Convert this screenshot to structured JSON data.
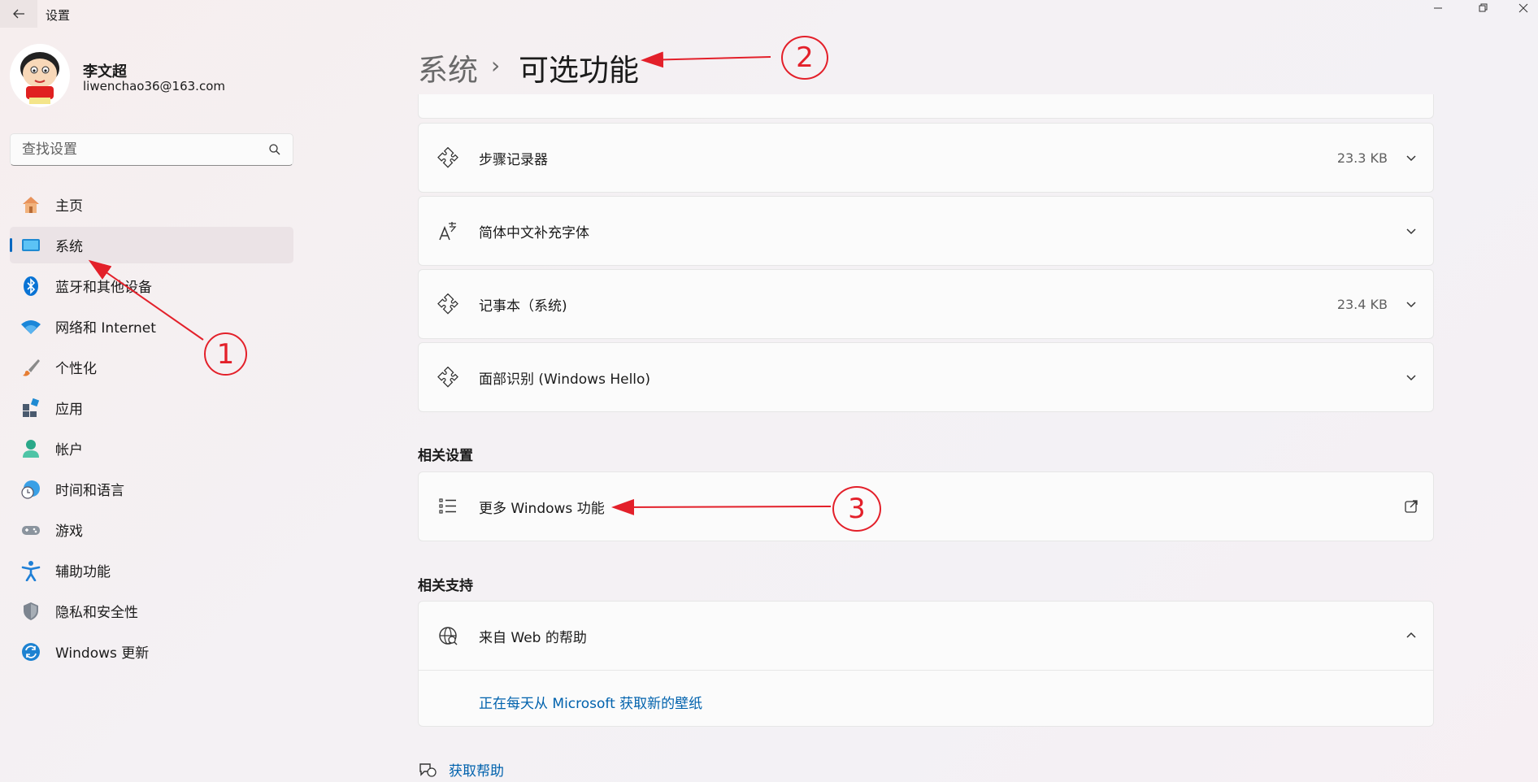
{
  "window": {
    "title": "设置"
  },
  "user": {
    "name": "李文超",
    "email": "liwenchao36@163.com"
  },
  "search": {
    "placeholder": "查找设置"
  },
  "nav": {
    "items": [
      {
        "label": "主页",
        "icon": "home-icon"
      },
      {
        "label": "系统",
        "icon": "system-icon",
        "active": true
      },
      {
        "label": "蓝牙和其他设备",
        "icon": "bluetooth-icon"
      },
      {
        "label": "网络和 Internet",
        "icon": "wifi-icon"
      },
      {
        "label": "个性化",
        "icon": "brush-icon"
      },
      {
        "label": "应用",
        "icon": "apps-icon"
      },
      {
        "label": "帐户",
        "icon": "account-icon"
      },
      {
        "label": "时间和语言",
        "icon": "globe-clock-icon"
      },
      {
        "label": "游戏",
        "icon": "gamepad-icon"
      },
      {
        "label": "辅助功能",
        "icon": "accessibility-icon"
      },
      {
        "label": "隐私和安全性",
        "icon": "shield-icon"
      },
      {
        "label": "Windows 更新",
        "icon": "update-icon"
      }
    ]
  },
  "header": {
    "breadcrumb": "系统",
    "separator": "›",
    "title": "可选功能"
  },
  "features": [
    {
      "label": "步骤记录器",
      "size": "23.3 KB"
    },
    {
      "label": "简体中文补充字体",
      "size": ""
    },
    {
      "label": "记事本（系统)",
      "size": "23.4 KB"
    },
    {
      "label": "面部识别 (Windows Hello)",
      "size": ""
    }
  ],
  "related_settings": {
    "heading": "相关设置",
    "item_label": "更多 Windows 功能"
  },
  "related_support": {
    "heading": "相关支持",
    "item_label": "来自 Web 的帮助",
    "link": "正在每天从 Microsoft 获取新的壁纸"
  },
  "footer": {
    "get_help": "获取帮助"
  },
  "annotations": {
    "one": "1",
    "two": "2",
    "three": "3",
    "color": "#e3202a"
  },
  "colors": {
    "accent": "#0067c0",
    "link": "#0062ad"
  }
}
